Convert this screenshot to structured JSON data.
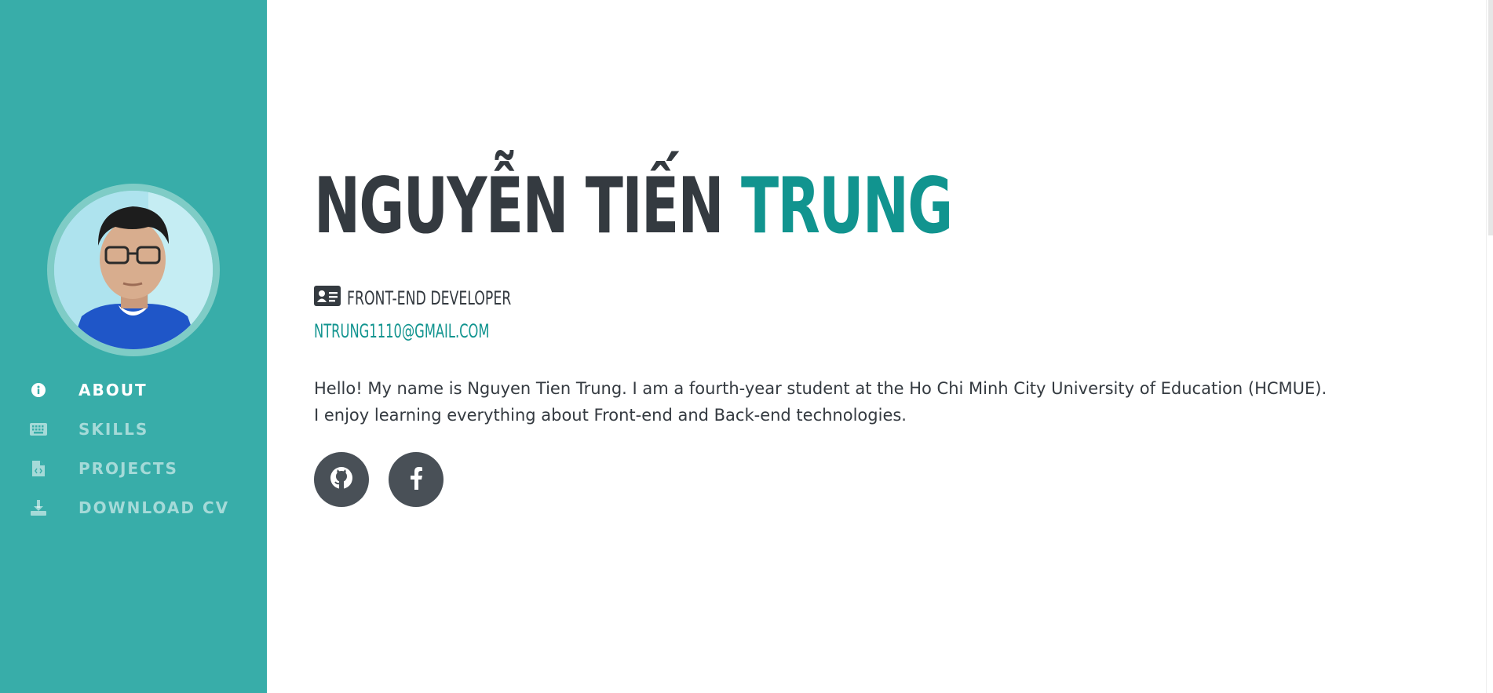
{
  "sidebar": {
    "background": "#38ada9",
    "nav": [
      {
        "label": "ABOUT",
        "icon": "info-circle-icon",
        "active": true
      },
      {
        "label": "SKILLS",
        "icon": "keyboard-icon",
        "active": false
      },
      {
        "label": "PROJECTS",
        "icon": "file-code-icon",
        "active": false
      },
      {
        "label": "DOWNLOAD CV",
        "icon": "download-icon",
        "active": false
      }
    ]
  },
  "profile": {
    "first_name": "NGUYỄN TIẾN",
    "last_name": "TRUNG",
    "role": "FRONT-END DEVELOPER",
    "role_icon": "id-card-icon",
    "email": "NTRUNG1110@GMAIL.COM",
    "bio_line1": "Hello! My name is Nguyen Tien Trung. I am a fourth-year student at the Ho Chi Minh City University of Education (HCMUE).",
    "bio_line2": "I enjoy learning everything about Front-end and Back-end technologies.",
    "accent_color": "#11948f"
  },
  "socials": [
    {
      "icon": "github-icon"
    },
    {
      "icon": "facebook-icon"
    }
  ]
}
